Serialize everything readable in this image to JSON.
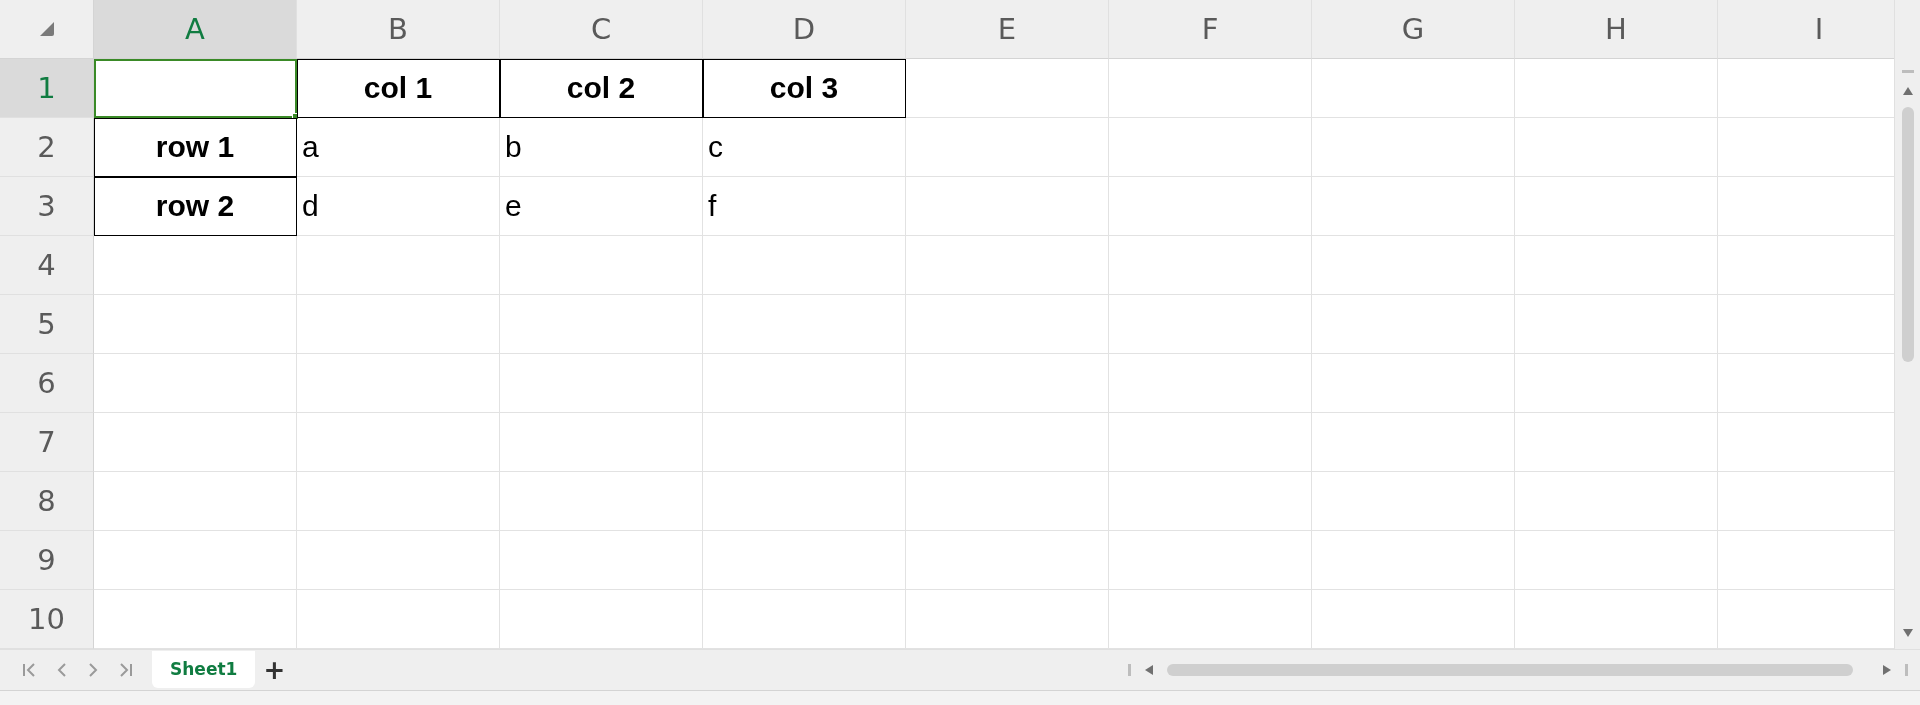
{
  "columns": [
    {
      "label": "A",
      "selected": true
    },
    {
      "label": "B",
      "selected": false
    },
    {
      "label": "C",
      "selected": false
    },
    {
      "label": "D",
      "selected": false
    },
    {
      "label": "E",
      "selected": false
    },
    {
      "label": "F",
      "selected": false
    },
    {
      "label": "G",
      "selected": false
    },
    {
      "label": "H",
      "selected": false
    },
    {
      "label": "I",
      "selected": false
    }
  ],
  "rows": [
    {
      "label": "1",
      "selected": true,
      "cells": [
        {
          "kind": "header",
          "bordered": true,
          "selected": true
        },
        {
          "kind": "header",
          "text": "col 1",
          "bordered": true,
          "selected": false
        },
        {
          "kind": "header",
          "text": "col 2",
          "bordered": true,
          "selected": false
        },
        {
          "kind": "header",
          "text": "col 3",
          "bordered": true,
          "selected": false
        }
      ]
    },
    {
      "label": "2",
      "selected": false,
      "cells": [
        {
          "kind": "header",
          "text": "row 1",
          "bordered": true,
          "selected": false
        },
        {
          "kind": "data",
          "text": "a",
          "bordered": false,
          "selected": false
        },
        {
          "kind": "data",
          "text": "b",
          "bordered": false,
          "selected": false
        },
        {
          "kind": "data",
          "text": "c",
          "bordered": false,
          "selected": false
        }
      ]
    },
    {
      "label": "3",
      "selected": false,
      "cells": [
        {
          "kind": "header",
          "text": "row 2",
          "bordered": true,
          "selected": false
        },
        {
          "kind": "data",
          "text": "d",
          "bordered": false,
          "selected": false
        },
        {
          "kind": "data",
          "text": "e",
          "bordered": false,
          "selected": false
        },
        {
          "kind": "data",
          "text": "f",
          "bordered": false,
          "selected": false
        }
      ]
    },
    {
      "label": "4",
      "selected": false
    },
    {
      "label": "5",
      "selected": false
    },
    {
      "label": "6",
      "selected": false
    },
    {
      "label": "7",
      "selected": false
    },
    {
      "label": "8",
      "selected": false
    },
    {
      "label": "9",
      "selected": false
    },
    {
      "label": "10",
      "selected": false
    }
  ],
  "sheet_tabs": [
    {
      "label": "Sheet1",
      "selected": true
    }
  ],
  "add_sheet": "+"
}
